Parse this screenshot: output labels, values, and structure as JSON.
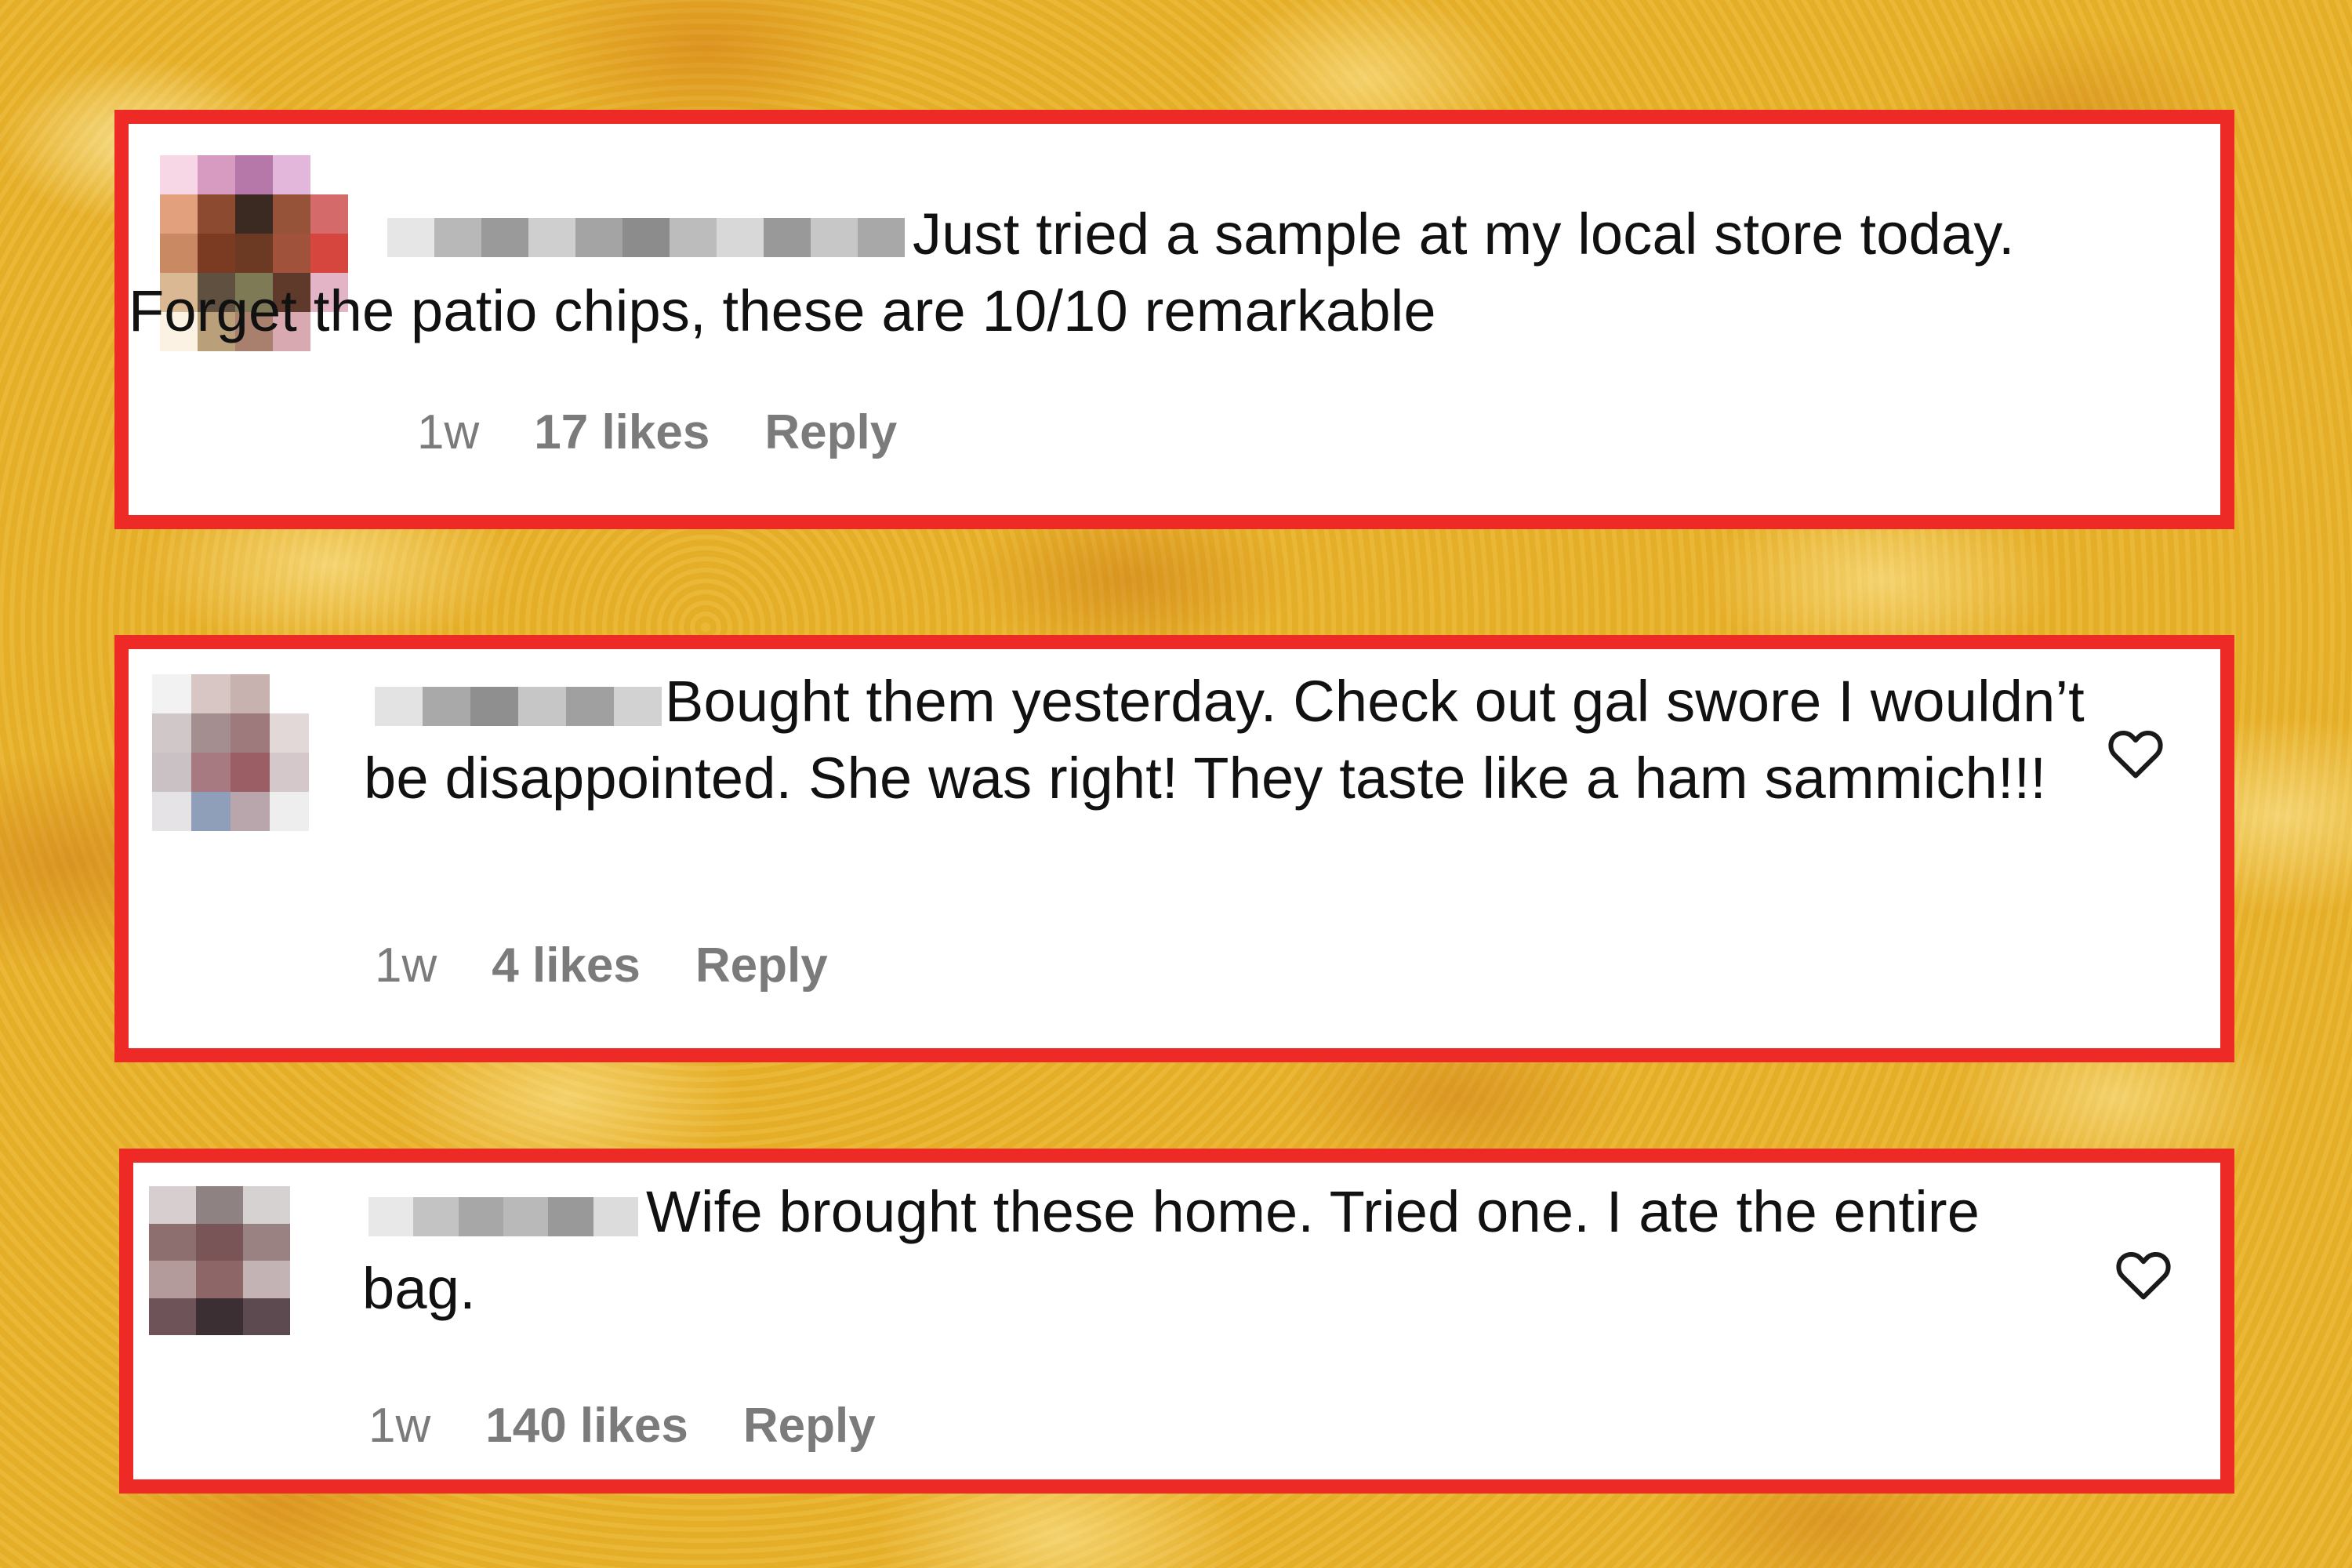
{
  "comments": [
    {
      "text_prefix_gap": "",
      "text": "Just tried a sample at my local store today. Forget the patio chips, these are 10/10 remarkable",
      "time": "1w",
      "likes": "17 likes",
      "reply": "Reply",
      "has_heart": false
    },
    {
      "text": "Bought them yesterday. Check out gal swore I wouldn’t be disappointed. She was right! They taste like a ham sammich!!!",
      "time": "1w",
      "likes": "4 likes",
      "reply": "Reply",
      "has_heart": true
    },
    {
      "text": "Wife brought these home. Tried one. I ate the entire bag.",
      "time": "1w",
      "likes": "140 likes",
      "reply": "Reply",
      "has_heart": true
    }
  ],
  "colors": {
    "card_border": "#ee2a26",
    "card_bg": "#ffffff",
    "text": "#111111",
    "meta": "#7b7b7b",
    "background": "#e9b32a"
  },
  "icons": {
    "like": "heart-outline-icon",
    "avatar": "pixelated-avatar",
    "username": "blurred-username"
  }
}
